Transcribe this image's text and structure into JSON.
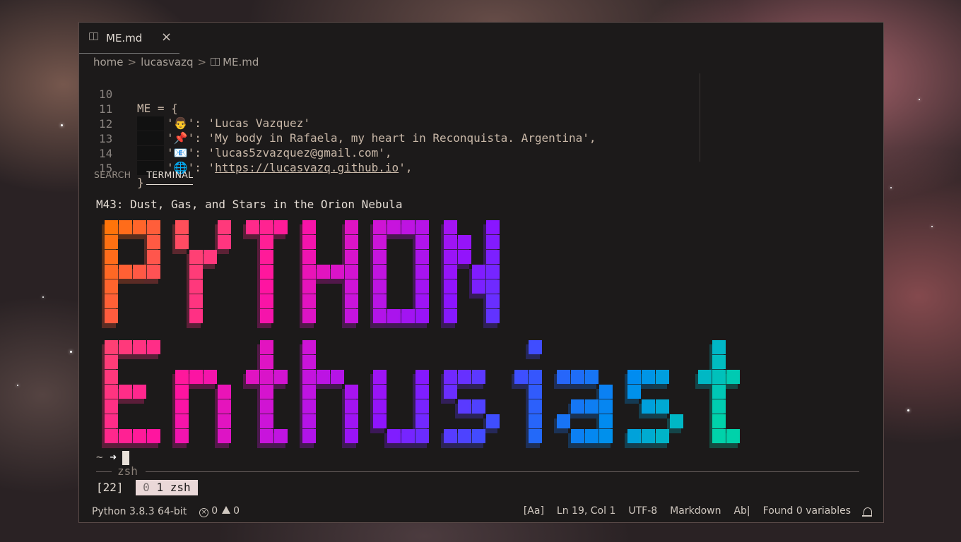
{
  "tab": {
    "label": "ME.md",
    "icon": "book-icon",
    "close": "×"
  },
  "breadcrumb": {
    "items": [
      "home",
      "lucasvazq",
      "ME.md"
    ],
    "sep": ">"
  },
  "editor": {
    "lines": [
      {
        "num": "10",
        "text": "ME = {"
      },
      {
        "num": "11",
        "emoji": "👨",
        "rest": "': 'Lucas Vazquez'"
      },
      {
        "num": "12",
        "emoji": "📌",
        "rest": "': 'My body in Rafaela, my heart in Reconquista. Argentina',"
      },
      {
        "num": "13",
        "emoji": "📧",
        "rest": "': 'lucas5zvazquez@gmail.com',"
      },
      {
        "num": "14",
        "emoji": "🌐",
        "url": "https://lucasvazq.github.io",
        "rest_end": "',"
      },
      {
        "num": "15",
        "text": "}"
      }
    ],
    "quote": "'"
  },
  "panel_tabs": [
    "SEARCH",
    "TERMINAL"
  ],
  "terminal": {
    "title": "M43: Dust, Gas, and Stars in the Orion Nebula",
    "art_words": [
      "PYTHON",
      "Enthusiast"
    ],
    "prompt_tilde": "~",
    "prompt_arrow": "➜",
    "zsh_label": "zsh",
    "tmux_session": "[22]",
    "tmux_window_index": "0",
    "tmux_window_name": "1 zsh"
  },
  "statusbar": {
    "python": "Python 3.8.3 64-bit",
    "errors": "0",
    "warnings": "0",
    "case": "[Aa]",
    "position": "Ln 19, Col 1",
    "encoding": "UTF-8",
    "language": "Markdown",
    "ab": "Ab|",
    "variables": "Found 0 variables"
  }
}
